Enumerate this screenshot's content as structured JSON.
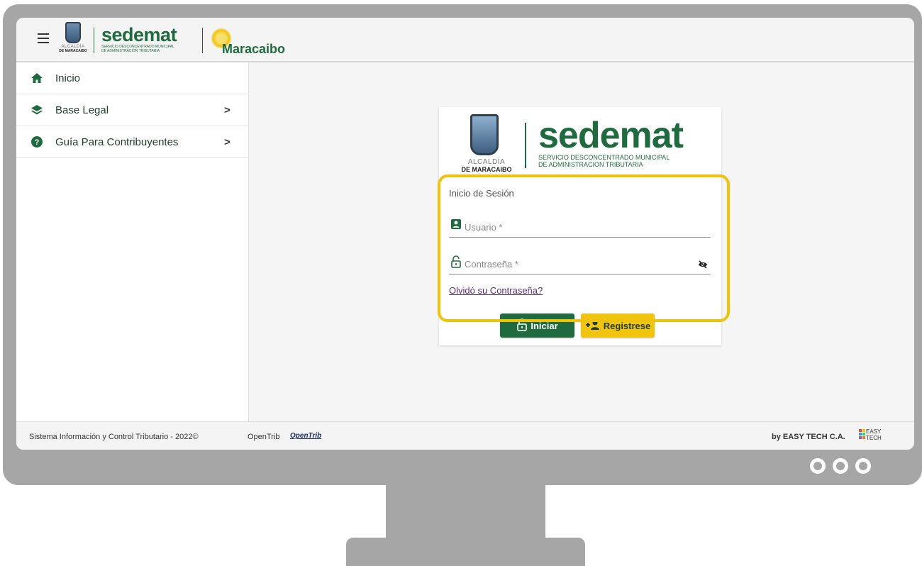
{
  "header": {
    "crest_line1": "ALCALDÍA",
    "crest_line2": "DE MARACAIBO",
    "brand_name": "sedemat",
    "brand_sub1": "SERVICIO DESCONCENTRADO MUNICIPAL",
    "brand_sub2": "DE ADMINISTRACION TRIBUTARIA",
    "city": "Maracaibo"
  },
  "sidebar": {
    "items": [
      {
        "label": "Inicio",
        "icon": "home-icon",
        "chevron": ""
      },
      {
        "label": "Base Legal",
        "icon": "layers-icon",
        "chevron": ">"
      },
      {
        "label": "Guía Para Contribuyentes",
        "icon": "help-circle-icon",
        "chevron": ">"
      }
    ]
  },
  "login": {
    "crest_line1": "ALCALDÍA",
    "crest_line2": "DE MARACAIBO",
    "brand_name": "sedemat",
    "brand_sub1": "SERVICIO DESCONCENTRADO MUNICIPAL",
    "brand_sub2": "DE ADMINISTRACION TRIBUTARIA",
    "title": "Inicio de Sesión",
    "username_placeholder": "Usuario *",
    "password_placeholder": "Contraseña *",
    "forgot": "Olvidó su Contraseña?",
    "login_button": "Iniciar",
    "register_button": "Registrese"
  },
  "footer": {
    "system": "Sistema Información y Control Tributario -  2022©",
    "opentrib": "OpenTrib",
    "opentrib_logo": "OpenTrib",
    "by": "by EASY TECH C.A.",
    "easy_line1": "EASY",
    "easy_line2": "TECH"
  },
  "colors": {
    "brand_green": "#1f6b3f",
    "accent_yellow": "#f1c40f",
    "highlight": "#efc20b",
    "monitor_frame": "#a6a6a6"
  }
}
